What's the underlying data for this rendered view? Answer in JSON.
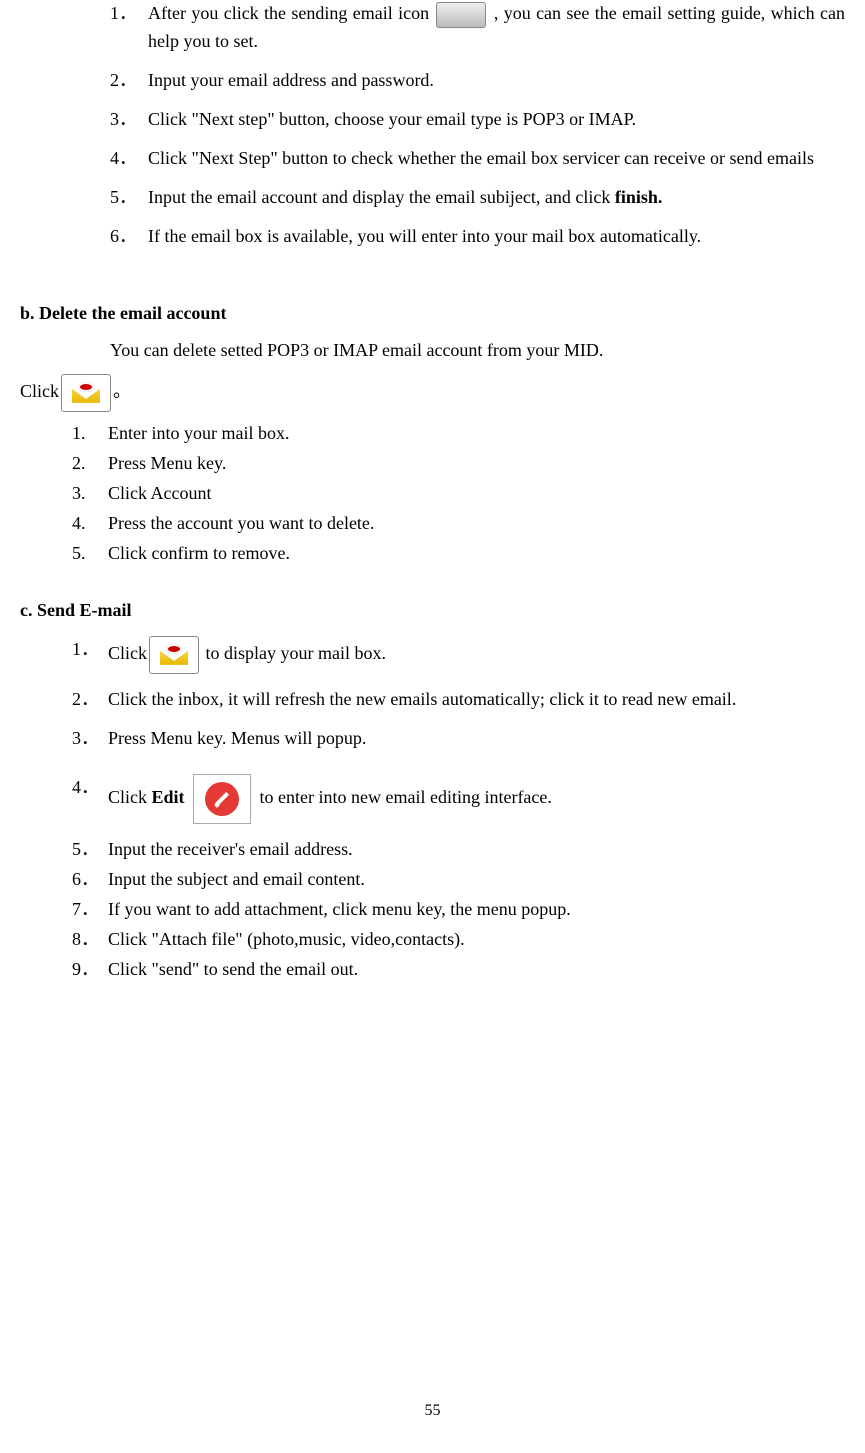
{
  "topList": {
    "item1": {
      "num": "1．",
      "pre": "After you click the sending email icon  ",
      "post": " , you can see the email setting guide, which can help you to set."
    },
    "item2": {
      "num": "2．",
      "text": "Input your email address and password."
    },
    "item3": {
      "num": "3．",
      "text": "Click \"Next step\" button, choose your email type is POP3 or IMAP."
    },
    "item4": {
      "num": "4．",
      "text": "Click \"Next Step\" button to check whether the email box servicer can receive or send emails"
    },
    "item5": {
      "num": "5．",
      "pre": "Input the email account and display the email subiject, and click ",
      "bold": "finish."
    },
    "item6": {
      "num": "6．",
      "text": "If the email box is available, you will enter into your mail box automatically."
    }
  },
  "sectionB": {
    "title": "b. Delete the email account",
    "intro": "You can delete setted POP3 or IMAP email account from your MID.",
    "clickPre": "Click",
    "clickPost": "。",
    "steps": {
      "s1": {
        "num": "1.",
        "text": "Enter into your mail box."
      },
      "s2": {
        "num": "2.",
        "text": "Press Menu key."
      },
      "s3": {
        "num": "3.",
        "text": "Click Account"
      },
      "s4": {
        "num": "4.",
        "text": "Press the account you want to delete."
      },
      "s5": {
        "num": "5.",
        "text": "Click confirm to remove."
      }
    }
  },
  "sectionC": {
    "title": "c.  Send E-mail",
    "steps": {
      "s1": {
        "num": "1．",
        "pre": "Click",
        "post": "   to display your mail box."
      },
      "s2": {
        "num": "2．",
        "text": "Click the inbox, it will refresh the new emails automatically; click it to read new email."
      },
      "s3": {
        "num": "3．",
        "text": "Press Menu key. Menus will popup."
      },
      "s4": {
        "num": "4．",
        "pre": "Click ",
        "bold": "Edit",
        "post": "  to enter into new email editing interface."
      },
      "s5": {
        "num": "5．",
        "text": "Input the receiver's email address."
      },
      "s6": {
        "num": "6．",
        "text": "Input the subject and email content."
      },
      "s7": {
        "num": "7．",
        "text": "If you want to add attachment, click menu key, the menu popup."
      },
      "s8": {
        "num": "8．",
        "text": "Click \"Attach file\" (photo,music, video,contacts)."
      },
      "s9": {
        "num": "9．",
        "text": "Click \"send\" to send the email out."
      }
    }
  },
  "pageNumber": "55"
}
